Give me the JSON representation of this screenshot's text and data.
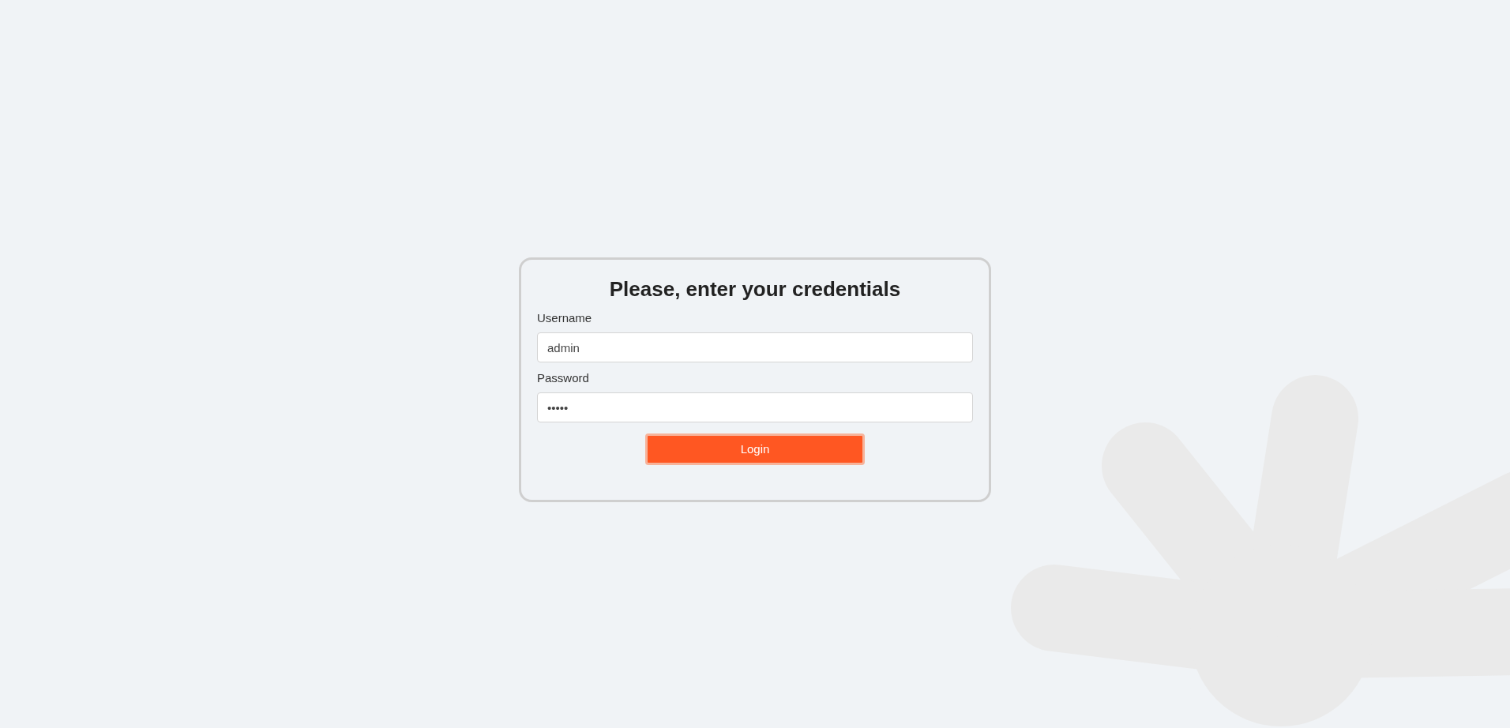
{
  "login_card": {
    "title": "Please, enter your credentials",
    "fields": [
      {
        "label": "Username",
        "value": "admin"
      },
      {
        "label": "Password",
        "value": "•••••"
      }
    ],
    "button": "Login"
  }
}
